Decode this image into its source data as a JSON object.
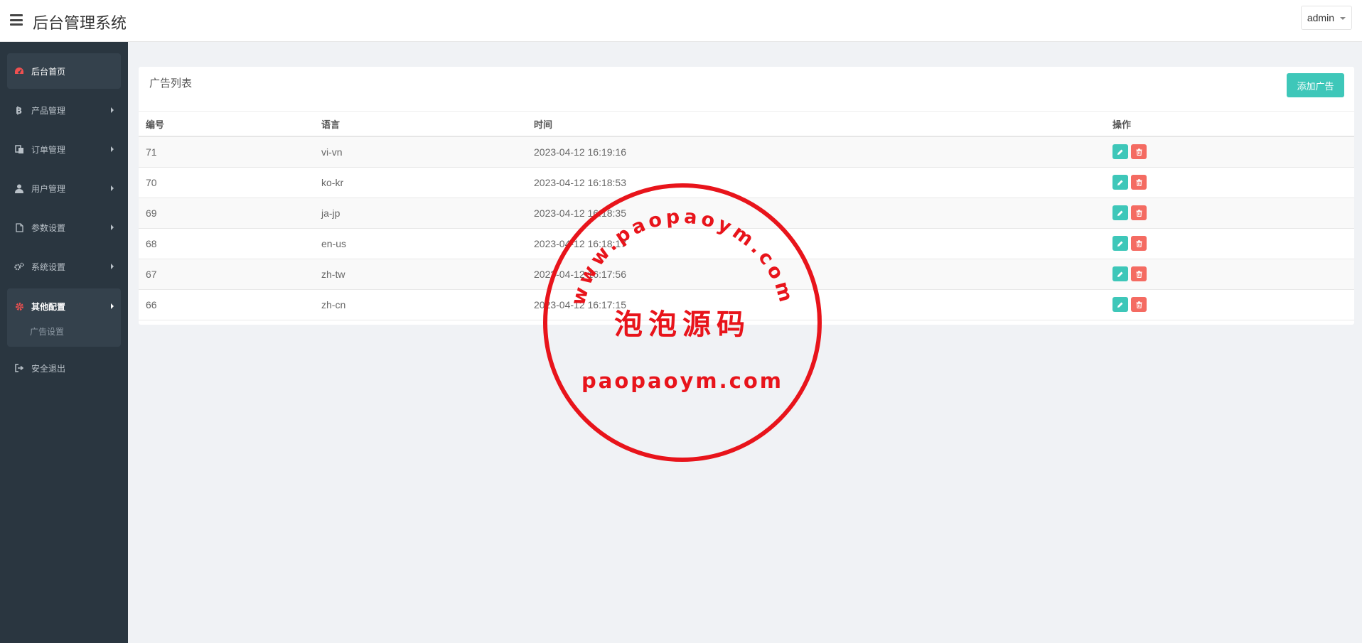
{
  "header": {
    "app_title": "后台管理系统",
    "user": "admin"
  },
  "sidebar": {
    "items": [
      {
        "label": "后台首页",
        "icon": "dashboard-icon"
      },
      {
        "label": "产品管理",
        "icon": "bitcoin-icon"
      },
      {
        "label": "订单管理",
        "icon": "copy-icon"
      },
      {
        "label": "用户管理",
        "icon": "user-icon"
      },
      {
        "label": "参数设置",
        "icon": "file-icon"
      },
      {
        "label": "系统设置",
        "icon": "cogs-icon"
      },
      {
        "label": "其他配置",
        "icon": "gear-icon"
      },
      {
        "label": "安全退出",
        "icon": "sign-out-icon"
      }
    ],
    "sub_items": {
      "other_config": [
        {
          "label": "广告设置"
        }
      ]
    }
  },
  "panel": {
    "title": "广告列表",
    "add_button": "添加广告",
    "columns": [
      "编号",
      "语言",
      "时间",
      "操作"
    ],
    "rows": [
      {
        "id": "71",
        "lang": "vi-vn",
        "time": "2023-04-12 16:19:16"
      },
      {
        "id": "70",
        "lang": "ko-kr",
        "time": "2023-04-12 16:18:53"
      },
      {
        "id": "69",
        "lang": "ja-jp",
        "time": "2023-04-12 16:18:35"
      },
      {
        "id": "68",
        "lang": "en-us",
        "time": "2023-04-12 16:18:17"
      },
      {
        "id": "67",
        "lang": "zh-tw",
        "time": "2023-04-12 16:17:56"
      },
      {
        "id": "66",
        "lang": "zh-cn",
        "time": "2023-04-12 16:17:15"
      }
    ]
  },
  "watermark": {
    "arc_text": "www.paopaoym.com",
    "center_text": "泡泡源码",
    "bottom_text": "paopaoym.com",
    "color": "#e8141b"
  },
  "colors": {
    "accent": "#3ec7b9",
    "danger": "#f46b62",
    "sidebar_bg": "#2a3640",
    "active_icon": "#f05050"
  }
}
